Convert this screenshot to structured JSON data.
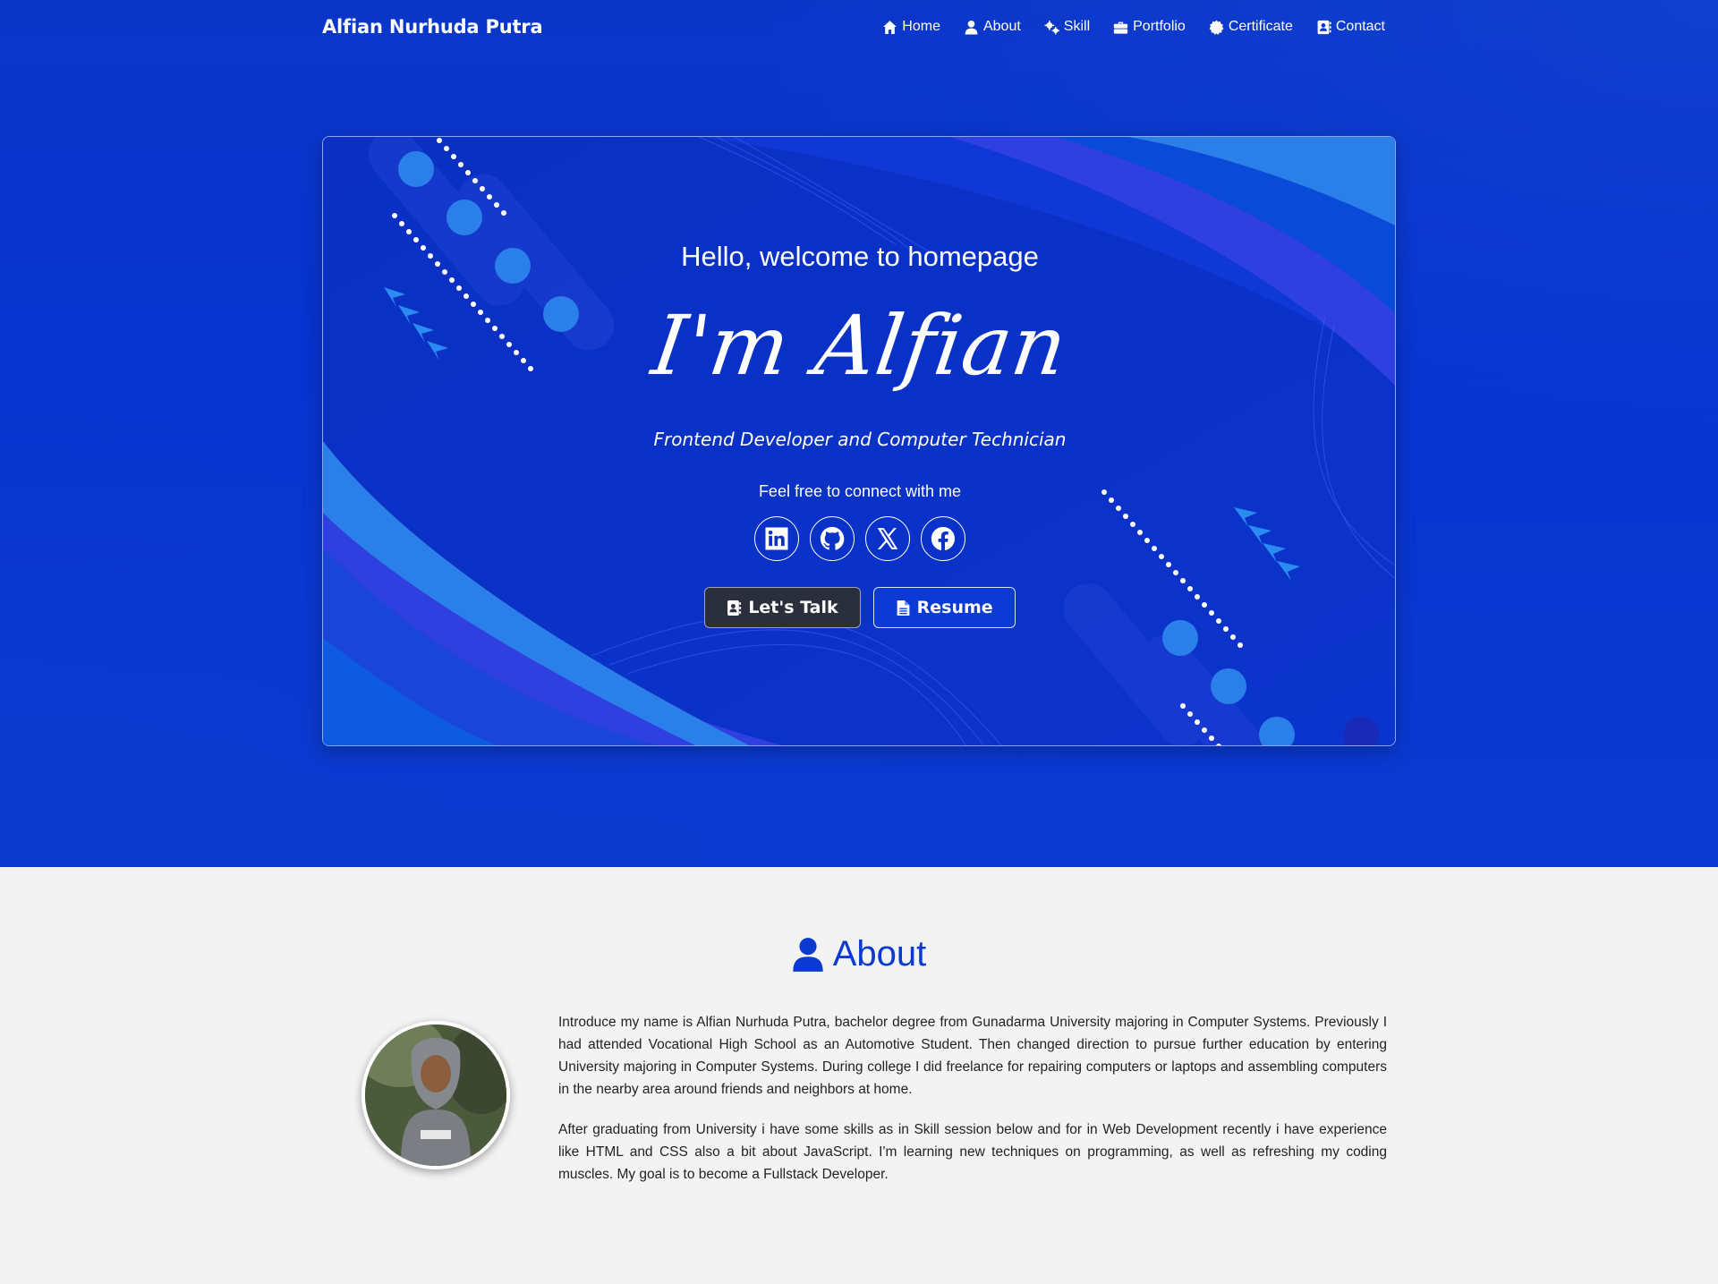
{
  "navbar": {
    "brand": "Alfian Nurhuda Putra",
    "links": [
      {
        "label": "Home",
        "icon": "home-icon"
      },
      {
        "label": "About",
        "icon": "user-icon"
      },
      {
        "label": "Skill",
        "icon": "gears-icon"
      },
      {
        "label": "Portfolio",
        "icon": "briefcase-icon"
      },
      {
        "label": "Certificate",
        "icon": "certificate-icon"
      },
      {
        "label": "Contact",
        "icon": "contact-book-icon"
      }
    ]
  },
  "hero": {
    "greeting": "Hello, welcome to homepage",
    "name": "I'm Alfian",
    "role": "Frontend Developer and Computer Technician",
    "connect_text": "Feel free to connect with me",
    "socials": [
      "linkedin-icon",
      "github-icon",
      "x-twitter-icon",
      "facebook-icon"
    ],
    "cta_primary": "Let's Talk",
    "cta_secondary": "Resume"
  },
  "about": {
    "title": "About",
    "paragraphs": [
      "Introduce my name is Alfian Nurhuda Putra, bachelor degree from Gunadarma University majoring in Computer Systems. Previously I had attended Vocational High School as an Automotive Student. Then changed direction to pursue further education by entering University majoring in Computer Systems. During college I did freelance for repairing computers or laptops and assembling computers in the nearby area around friends and neighbors at home.",
      "After graduating from University i have some skills as in Skill session below and for in Web Development recently i have experience like HTML and CSS also a bit about JavaScript. I'm learning new techniques on programming, as well as refreshing my coding muscles. My goal is to become a Fullstack Developer."
    ]
  },
  "colors": {
    "primary": "#0a3ad0",
    "hero_bg": "#0733cf",
    "card_bg": "#0a30c4",
    "accent_light": "#2a7fe8",
    "dark_button": "#2b2f3b",
    "page_bg": "#f3f3f3"
  }
}
